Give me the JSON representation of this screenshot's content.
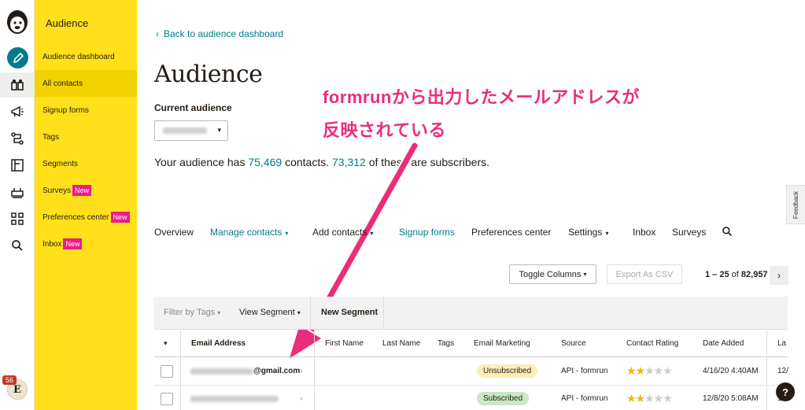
{
  "rail": {
    "icons": [
      "mailchimp-logo",
      "pencil-icon",
      "audience-icon",
      "megaphone-icon",
      "automation-icon",
      "website-icon",
      "integrations-icon",
      "grid-icon",
      "search-icon"
    ],
    "avatar_letter": "E",
    "notification_count": "56"
  },
  "nav": {
    "title": "Audience",
    "items": [
      {
        "label": "Audience dashboard"
      },
      {
        "label": "All contacts"
      },
      {
        "label": "Signup forms"
      },
      {
        "label": "Tags"
      },
      {
        "label": "Segments"
      },
      {
        "label": "Surveys",
        "badge": "New"
      },
      {
        "label": "Preferences center",
        "badge": "New"
      },
      {
        "label": "Inbox",
        "badge": "New"
      }
    ]
  },
  "main": {
    "back_link": "Back to audience dashboard",
    "title": "Audience",
    "current_audience_label": "Current audience",
    "summary": {
      "prefix": "Your audience has",
      "contacts": "75,469",
      "middle": "contacts.",
      "subscribers": "73,312",
      "suffix": "of these are subscribers."
    }
  },
  "annotation": {
    "line1": "formrunから出力したメールアドレスが",
    "line2": "反映されている",
    "color": "#ec2d7b"
  },
  "feedback_label": "Feedback",
  "tabs": [
    {
      "label": "Overview"
    },
    {
      "label": "Manage contacts",
      "dropdown": true
    },
    {
      "label": "Add contacts",
      "dropdown": true
    },
    {
      "label": "Signup forms"
    },
    {
      "label": "Preferences center"
    },
    {
      "label": "Settings",
      "dropdown": true
    },
    {
      "label": "Inbox"
    },
    {
      "label": "Surveys"
    }
  ],
  "toolbar": {
    "toggle_columns": "Toggle Columns",
    "export_csv": "Export As CSV",
    "pager_range": "1 – 25",
    "pager_of": "of",
    "pager_total": "82,957"
  },
  "filterbar": {
    "filter_by_tags": "Filter by Tags",
    "view_segment": "View Segment",
    "new_segment": "New Segment"
  },
  "table": {
    "columns": [
      "Email Address",
      "First Name",
      "Last Name",
      "Tags",
      "Email Marketing",
      "Source",
      "Contact Rating",
      "Date Added",
      "La"
    ],
    "rows": [
      {
        "email_visible": "@gmail.com",
        "email_marketing": "Unsubscribed",
        "source": "API - formrun",
        "rating": 2,
        "date_added": "4/16/20 4:40AM",
        "last": "12/"
      },
      {
        "email_visible": "",
        "email_marketing": "Subscribed",
        "source": "API - formrun",
        "rating": 2,
        "date_added": "12/8/20 5:08AM",
        "last": "12/"
      }
    ]
  },
  "help_label": "?",
  "colors": {
    "accent_teal": "#007c89",
    "nav_yellow": "#ffe01b",
    "new_badge": "#ec1b8a",
    "star": "#f2b600"
  }
}
